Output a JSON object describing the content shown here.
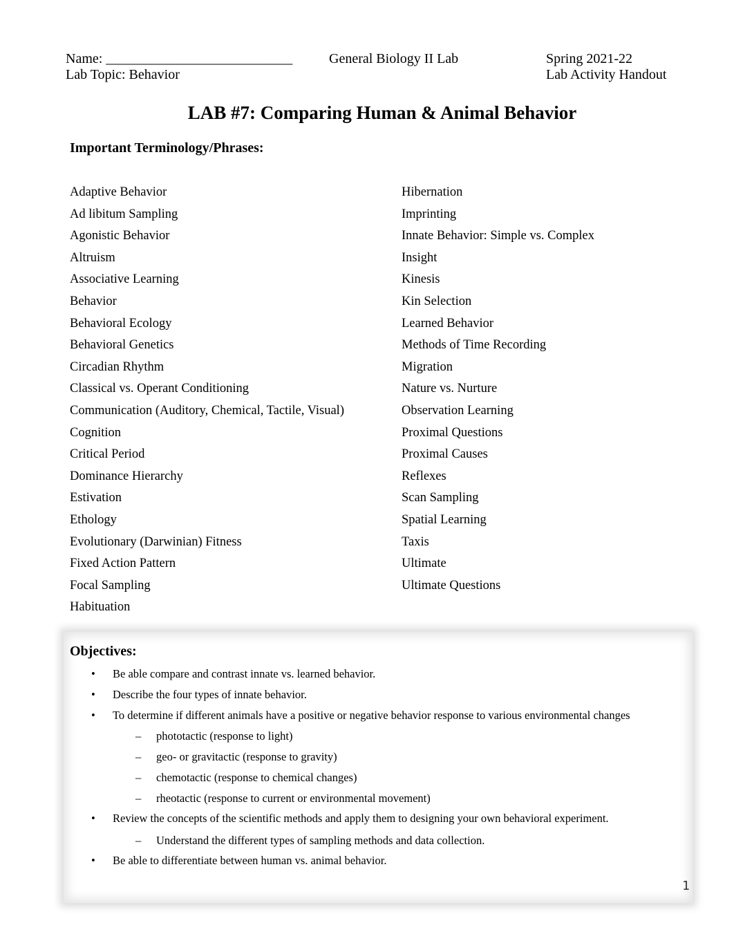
{
  "header": {
    "name_label": "Name: ___________________________",
    "course": "General Biology II Lab",
    "term": "Spring 2021-22",
    "topic": "Lab Topic: Behavior",
    "doc_type": "Lab Activity Handout"
  },
  "title": "LAB #7: Comparing Human & Animal Behavior",
  "terminology": {
    "heading": "Important Terminology/Phrases:",
    "left": [
      "Adaptive Behavior",
      "Ad libitum Sampling",
      "Agonistic Behavior",
      "Altruism",
      "Associative Learning",
      "Behavior",
      "Behavioral Ecology",
      "Behavioral Genetics",
      "Circadian Rhythm",
      "Classical vs. Operant Conditioning",
      "Communication (Auditory, Chemical, Tactile, Visual)",
      "Cognition",
      "Critical Period",
      "Dominance Hierarchy",
      "Estivation",
      "Ethology",
      "Evolutionary (Darwinian) Fitness",
      "Fixed Action Pattern",
      "Focal Sampling",
      "Habituation"
    ],
    "right": [
      "Hibernation",
      "Imprinting",
      "Innate Behavior: Simple vs. Complex",
      "Insight",
      "Kinesis",
      "Kin Selection",
      "Learned Behavior",
      "Methods of Time Recording",
      "Migration",
      "Nature vs. Nurture",
      "Observation Learning",
      "Proximal Questions",
      "Proximal Causes",
      "Reflexes",
      "Scan Sampling",
      "Spatial Learning",
      "Taxis",
      "Ultimate",
      "Ultimate Questions"
    ]
  },
  "objectives": {
    "heading": "Objectives:",
    "items": [
      {
        "level": 1,
        "marker": "•",
        "text": "Be able compare and contrast innate vs. learned behavior."
      },
      {
        "level": 1,
        "marker": "•",
        "text": "Describe the four types of innate behavior."
      },
      {
        "level": 1,
        "marker": "•",
        "text": "To determine if different animals have a positive or negative behavior response to various environmental changes"
      },
      {
        "level": 2,
        "marker": "–",
        "text": "phototactic (response to light)"
      },
      {
        "level": 2,
        "marker": "–",
        "text": "geo- or gravitactic (response to gravity)"
      },
      {
        "level": 2,
        "marker": "–",
        "text": "chemotactic (response to chemical changes)"
      },
      {
        "level": 2,
        "marker": "–",
        "text": "rheotactic (response to current or environmental movement)"
      },
      {
        "level": 1,
        "marker": "•",
        "text": "Review the concepts of the scientific methods and apply them to designing your own behavioral experiment."
      },
      {
        "level": 2,
        "marker": "–",
        "text": "Understand the different types of sampling methods and data collection."
      },
      {
        "level": 1,
        "marker": "•",
        "text": "Be able to differentiate between human vs. animal behavior."
      }
    ]
  },
  "page_number": "1"
}
